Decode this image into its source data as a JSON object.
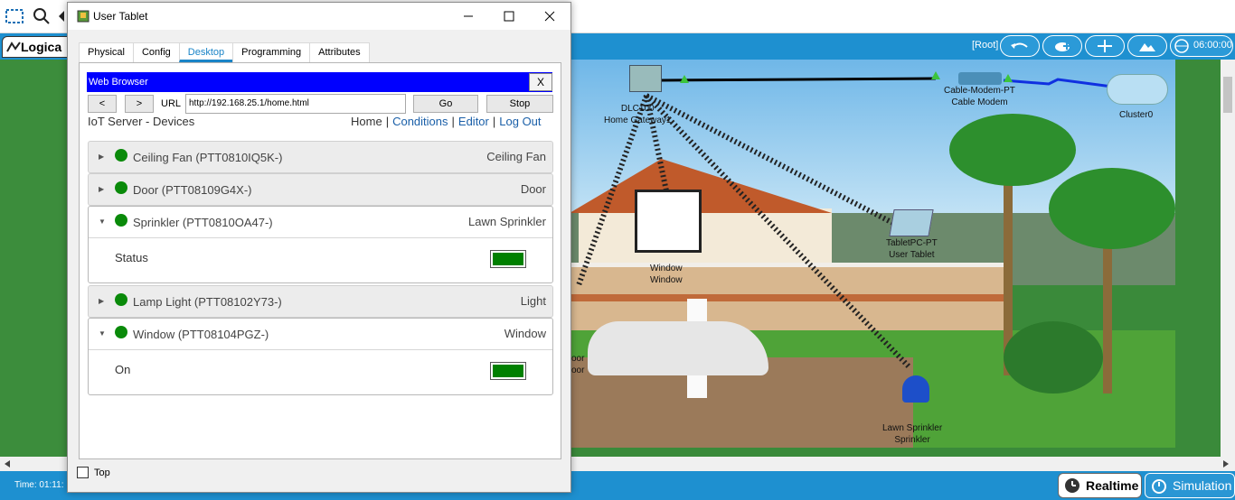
{
  "app": {
    "logical_tab_label": "Logica",
    "root_label": "[Root]",
    "clock": "06:00:00",
    "time_label": "Time: 01:11:",
    "realtime_label": "Realtime",
    "simulation_label": "Simulation"
  },
  "scene": {
    "devices": [
      {
        "label": "DLC100\nHome Gateway1"
      },
      {
        "label": "Cable-Modem-PT\nCable Modem"
      },
      {
        "label": "Cluster0"
      },
      {
        "label": "TabletPC-PT\nUser Tablet"
      },
      {
        "label": "Window\nWindow"
      },
      {
        "label": "Lawn Sprinkler\nSprinkler"
      },
      {
        "label": "oor\noor"
      }
    ]
  },
  "dialog": {
    "title": "User Tablet",
    "tabs": [
      "Physical",
      "Config",
      "Desktop",
      "Programming",
      "Attributes"
    ],
    "active_tab": "Desktop",
    "top_label": "Top",
    "browser": {
      "title": "Web Browser",
      "close": "X",
      "back": "<",
      "forward": ">",
      "url_label": "URL",
      "url": "http://192.168.25.1/home.html",
      "go": "Go",
      "stop": "Stop"
    },
    "iot": {
      "title": "IoT Server - Devices",
      "nav": {
        "home": "Home",
        "sep": "|",
        "conditions": "Conditions",
        "editor": "Editor",
        "logout": "Log Out"
      },
      "devices": [
        {
          "name": "Ceiling Fan (PTT0810IQ5K-)",
          "type": "Ceiling Fan",
          "expanded": false
        },
        {
          "name": "Door (PTT08109G4X-)",
          "type": "Door",
          "expanded": false
        },
        {
          "name": "Sprinkler (PTT0810OA47-)",
          "type": "Lawn Sprinkler",
          "expanded": true,
          "prop_label": "Status",
          "prop_color": "#008000"
        },
        {
          "name": "Lamp Light (PTT08102Y73-)",
          "type": "Light",
          "expanded": false
        },
        {
          "name": "Window (PTT08104PGZ-)",
          "type": "Window",
          "expanded": true,
          "prop_label": "On",
          "prop_color": "#008000"
        }
      ]
    }
  }
}
